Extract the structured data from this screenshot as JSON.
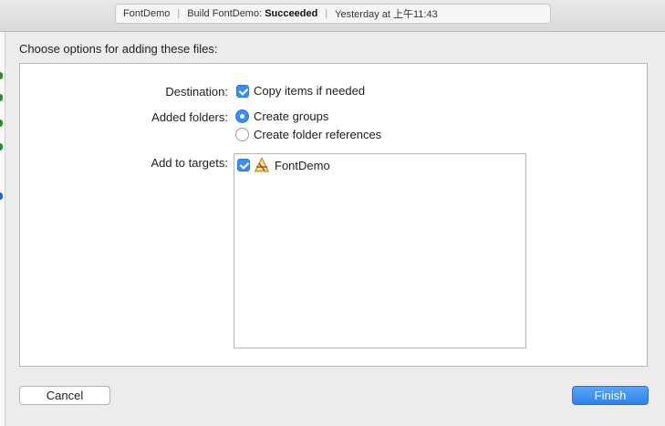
{
  "activity": {
    "project": "FontDemo",
    "build_prefix": "Build FontDemo:",
    "build_status": "Succeeded",
    "time": "Yesterday at 上午11:43"
  },
  "sheet": {
    "title": "Choose options for adding these files:",
    "destination": {
      "label": "Destination:",
      "option": "Copy items if needed",
      "checked": true
    },
    "added_folders": {
      "label": "Added folders:",
      "options": [
        "Create groups",
        "Create folder references"
      ],
      "selected": "Create groups"
    },
    "targets": {
      "label": "Add to targets:",
      "items": [
        {
          "name": "FontDemo",
          "icon": "xcode-app-icon",
          "checked": true
        }
      ]
    },
    "buttons": {
      "cancel": "Cancel",
      "finish": "Finish"
    }
  },
  "colors": {
    "accent": "#3a8ef0",
    "panel": "#ffffff",
    "background": "#ececec"
  }
}
